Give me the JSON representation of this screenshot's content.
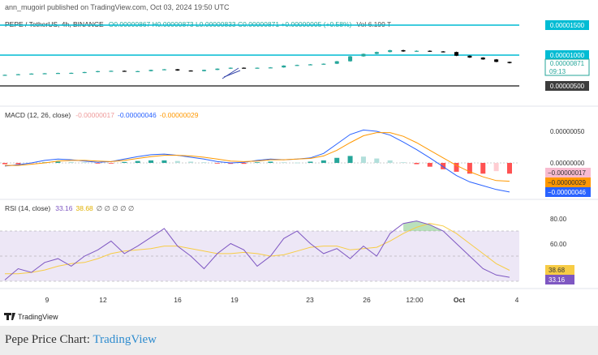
{
  "publish_line": "ann_mugoirl published on TradingView.com, Oct 03, 2024 19:50 UTC",
  "price_header": {
    "symbol": "PEPE / TetherUS, 4h, BINANCE",
    "ohlc": "O0.00000867 H0.00000873 L0.00000833 C0.00000871 +0.00000005 (+0.58%)",
    "volume": "Vol 6.199 T"
  },
  "price_tags": {
    "upper_line": "0.00001500",
    "mid_line": "0.00001000",
    "last_price": "0.00000871",
    "countdown": "09:13",
    "lower_line": "0.00000500"
  },
  "macd_header": {
    "name": "MACD (12, 26, close)",
    "hist_value": "-0.00000017",
    "macd_value": "-0.00000046",
    "signal_value": "-0.00000029"
  },
  "macd_axis": {
    "tick_upper": "0.00000050",
    "tick_zero": "0.00000000"
  },
  "macd_tags": {
    "hist": "−0.00000017",
    "signal": "−0.00000029",
    "macd": "−0.00000046"
  },
  "rsi_header": {
    "name": "RSI (14, close)",
    "rsi_value": "33.16",
    "ma_value": "38.68",
    "extra": "∅ ∅ ∅ ∅ ∅"
  },
  "rsi_axis": {
    "tick_80": "80.00",
    "tick_60": "60.00"
  },
  "rsi_tags": {
    "ma": "38.68",
    "rsi": "33.16"
  },
  "x_axis_labels": [
    "9",
    "12",
    "16",
    "19",
    "23",
    "26",
    "12:00",
    "Oct",
    "4"
  ],
  "watermark": "TradingView",
  "caption": {
    "prefix": "Pepe Price Chart:",
    "link": "TradingView"
  },
  "colors": {
    "up": "#26a69a",
    "down": "#000000",
    "level_line": "#00bcd4",
    "macd_line": "#2962ff",
    "signal_line": "#ff9800",
    "rsi_line": "#7e57c2",
    "rsi_ma": "#f7cc45",
    "rsi_band": "#ede7f6"
  },
  "chart_data": [
    {
      "type": "line",
      "title": "PEPE / TetherUS, 4h, BINANCE",
      "x_ticks": [
        "9",
        "12",
        "16",
        "19",
        "23",
        "26",
        "12:00",
        "Oct",
        "4"
      ],
      "y_ticks": [
        "0.00001500",
        "0.00001000",
        "0.00000500"
      ],
      "horizontal_levels": [
        1.5e-05,
        1e-05,
        5e-06
      ],
      "last_price": 8.71e-06,
      "series": [
        {
          "name": "Close",
          "values": [
            6.8e-06,
            6.9e-06,
            7e-06,
            7.05e-06,
            7.1e-06,
            7.12e-06,
            7.25e-06,
            7.4e-06,
            7.45e-06,
            7.35e-06,
            7.4e-06,
            7.6e-06,
            7.7e-06,
            7.5e-06,
            7.4e-06,
            7.6e-06,
            7.8e-06,
            7.95e-06,
            7.9e-06,
            7.95e-06,
            8e-06,
            8.3e-06,
            8.4e-06,
            8.5e-06,
            8.6e-06,
            9e-06,
            9.8e-06,
            1.02e-05,
            1.05e-05,
            1.08e-05,
            1.06e-05,
            1.07e-05,
            1.06e-05,
            1.05e-05,
            9.9e-06,
            9.6e-06,
            9.3e-06,
            8.9e-06,
            8.71e-06
          ]
        }
      ]
    },
    {
      "type": "bar",
      "title": "MACD (12, 26, close)",
      "y_ticks": [
        "0.00000050",
        "0.00000000"
      ],
      "series": [
        {
          "name": "Histogram",
          "values": [
            -2e-08,
            -2e-08,
            -1e-08,
            1e-08,
            2e-08,
            1.5e-08,
            1e-08,
            -5e-09,
            -1e-08,
            1.5e-08,
            3e-08,
            4e-08,
            4e-08,
            3e-08,
            2e-08,
            1e-08,
            -5e-09,
            -1.5e-08,
            -1.5e-08,
            1e-08,
            2e-08,
            1e-08,
            5e-09,
            2e-08,
            4e-08,
            8e-08,
            1.1e-07,
            1e-07,
            7e-08,
            4e-08,
            1e-08,
            -2e-08,
            -6e-08,
            -1e-07,
            -1.4e-07,
            -1.7e-07,
            -1.7e-07,
            -1.3e-07,
            -1.7e-07
          ]
        },
        {
          "name": "MACD",
          "values": [
            -5e-08,
            -3e-08,
            0.0,
            4e-08,
            6e-08,
            5e-08,
            3e-08,
            1e-08,
            2e-08,
            6e-08,
            1e-07,
            1.3e-07,
            1.4e-07,
            1.2e-07,
            9e-08,
            6e-08,
            2e-08,
            0.0,
            1e-08,
            4e-08,
            6e-08,
            5e-08,
            6e-08,
            8e-08,
            1.5e-07,
            3e-07,
            4.5e-07,
            5.2e-07,
            5e-07,
            4.4e-07,
            3.3e-07,
            2.1e-07,
            8e-08,
            -6e-08,
            -2e-07,
            -3e-07,
            -3.6e-07,
            -4.2e-07,
            -4.6e-07
          ]
        },
        {
          "name": "Signal",
          "values": [
            -4e-08,
            -4e-08,
            -2e-08,
            0.0,
            3e-08,
            4e-08,
            4e-08,
            3e-08,
            2e-08,
            4e-08,
            7e-08,
            1e-07,
            1.2e-07,
            1.2e-07,
            1.1e-07,
            9e-08,
            6e-08,
            3e-08,
            2e-08,
            3e-08,
            5e-08,
            5e-08,
            6e-08,
            7e-08,
            1.1e-07,
            2e-07,
            3.2e-07,
            4.3e-07,
            4.8e-07,
            4.8e-07,
            4.2e-07,
            3.2e-07,
            2e-07,
            8e-08,
            -4e-08,
            -1.4e-07,
            -2.2e-07,
            -2.8e-07,
            -2.9e-07
          ]
        }
      ]
    },
    {
      "type": "line",
      "title": "RSI (14, close)",
      "y_ticks": [
        "80.00",
        "60.00"
      ],
      "bands": [
        70,
        50,
        30
      ],
      "ylim": [
        25,
        85
      ],
      "series": [
        {
          "name": "RSI",
          "values": [
            31,
            40,
            37,
            45,
            48,
            42,
            50,
            55,
            62,
            52,
            58,
            65,
            72,
            58,
            50,
            40,
            52,
            60,
            55,
            42,
            50,
            64,
            70,
            60,
            52,
            56,
            48,
            58,
            50,
            68,
            76,
            78,
            75,
            70,
            60,
            50,
            40,
            35,
            33.16
          ]
        },
        {
          "name": "RSI MA",
          "values": [
            36,
            36,
            37,
            39,
            42,
            44,
            45,
            48,
            52,
            54,
            55,
            56,
            58,
            58,
            56,
            54,
            52,
            52,
            53,
            52,
            50,
            51,
            54,
            57,
            58,
            58,
            55,
            56,
            57,
            62,
            68,
            73,
            76,
            74,
            68,
            60,
            52,
            44,
            38.68
          ]
        }
      ]
    }
  ]
}
